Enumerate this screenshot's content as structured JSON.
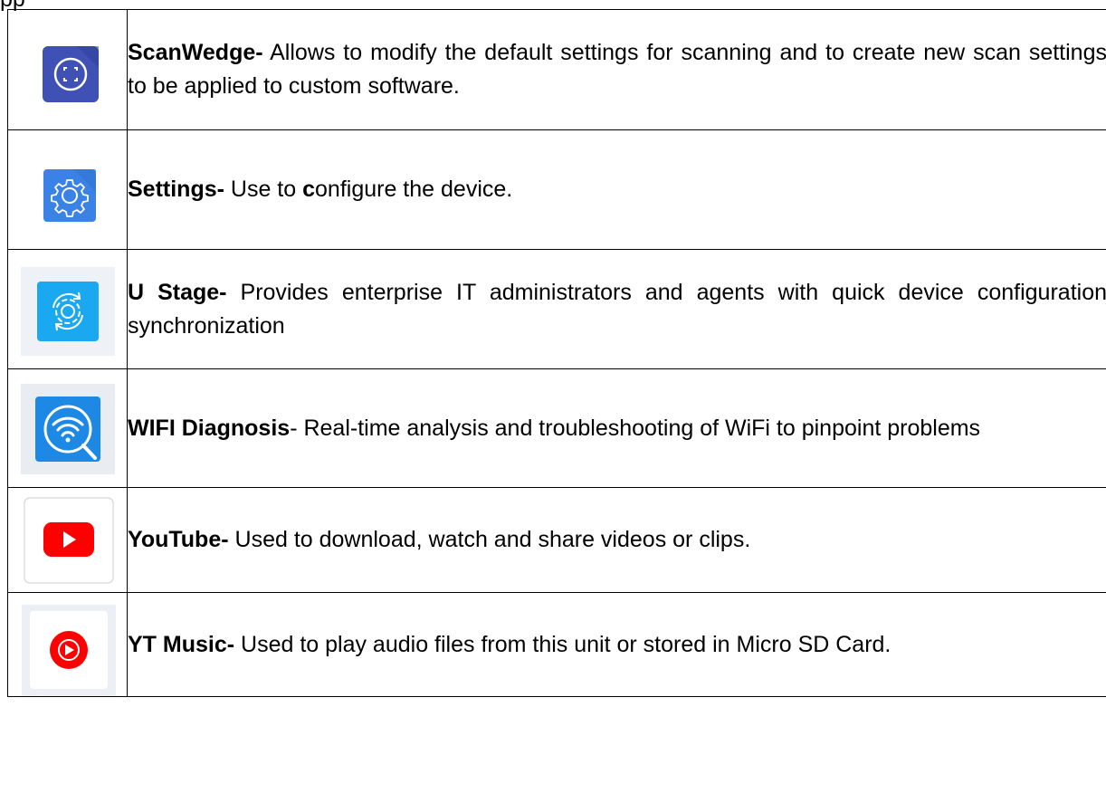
{
  "top_fragment": "pp",
  "apps": [
    {
      "name": "ScanWedge-",
      "desc": " Allows to modify the default settings for scanning and to create new scan settings to be applied to custom software.",
      "icon": "scanwedge-icon",
      "color": "#3f51b5"
    },
    {
      "name": "Settings-",
      "desc_pre": " Use to ",
      "desc_bold": "c",
      "desc_post": "onfigure the device.",
      "icon": "settings-gear-icon",
      "color": "#3b82e6"
    },
    {
      "name": "U Stage-",
      "desc": " Provides enterprise IT administrators and agents with quick device configuration synchronization",
      "icon": "ustage-sync-icon",
      "color": "#1aa9f0"
    },
    {
      "name": "WIFI Diagnosis",
      "desc": "- Real-time analysis and troubleshooting of WiFi to pinpoint problems",
      "icon": "wifi-diagnosis-icon",
      "color": "#1e88e5"
    },
    {
      "name": "YouTube-",
      "desc": " Used to download, watch and share videos or clips.",
      "icon": "youtube-icon",
      "color": "#ff0000"
    },
    {
      "name": "YT Music-",
      "desc": " Used to play audio files from this unit or stored in Micro SD Card.",
      "icon": "yt-music-icon",
      "color": "#ff0000"
    }
  ]
}
